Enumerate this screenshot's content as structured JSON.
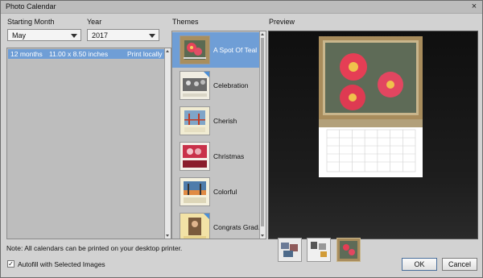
{
  "window": {
    "title": "Photo Calendar",
    "close_glyph": "×"
  },
  "starting_month": {
    "label": "Starting Month",
    "value": "May"
  },
  "year": {
    "label": "Year",
    "value": "2017"
  },
  "size_list": {
    "rows": [
      {
        "months": "12 months",
        "size": "11.00 x 8.50 inches",
        "print": "Print locally"
      }
    ]
  },
  "themes": {
    "label": "Themes",
    "items": [
      {
        "name": "A Spot Of Teal",
        "selected": true
      },
      {
        "name": "Celebration"
      },
      {
        "name": "Cherish"
      },
      {
        "name": "Christmas"
      },
      {
        "name": "Colorful"
      },
      {
        "name": "Congrats Grad..."
      }
    ]
  },
  "preview": {
    "label": "Preview"
  },
  "note": "Note: All calendars can be printed on your desktop printer.",
  "autofill": {
    "label": "Autofill with Selected Images",
    "checked": true
  },
  "buttons": {
    "ok": "OK",
    "cancel": "Cancel"
  }
}
